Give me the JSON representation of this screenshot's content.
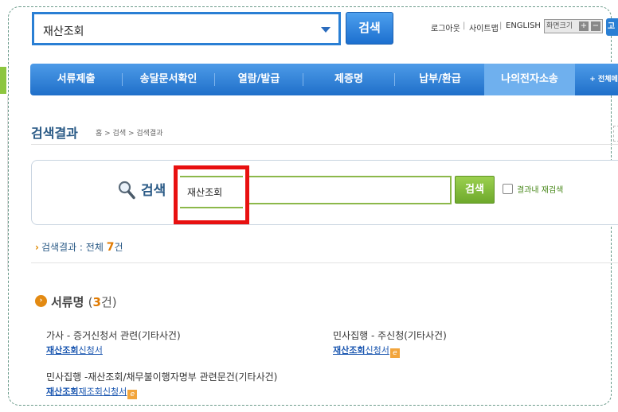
{
  "header": {
    "search_value": "재산조회",
    "search_button": "검색",
    "links": {
      "logout": "로그아웃",
      "sitemap": "사이트맵",
      "english": "ENGLISH",
      "separator": "|"
    },
    "font_size": {
      "label": "화면크기",
      "plus": "+",
      "minus": "−"
    },
    "edge_button": "고"
  },
  "nav": {
    "items": [
      "서류제출",
      "송달문서확인",
      "열람/발급",
      "제증명",
      "납부/환급",
      "나의전자소송"
    ],
    "active": "나의전자소송",
    "all_menu": "+ 전체메"
  },
  "page": {
    "title": "검색결과",
    "breadcrumb": "홈 > 검색 > 검색결과"
  },
  "search_box": {
    "label": "검색",
    "value": "재산조회",
    "button": "검색",
    "research_label": "결과내 재검색",
    "research_checked": false
  },
  "results": {
    "summary_label": "검색결과 : 전체",
    "total": "7",
    "unit": "건",
    "section": {
      "title": "서류명",
      "count": "3",
      "unit": "건"
    },
    "docs": [
      {
        "category": "가사 - 증거신청서 관련(기타사건)",
        "highlight": "재산조회",
        "rest": "신청서",
        "ie": false
      },
      {
        "category": "민사집행 - 주신청(기타사건)",
        "highlight": "재산조회",
        "rest": "신청서",
        "ie": true
      },
      {
        "category": "민사집행 -재산조회/채무불이행자명부 관련문건(기타사건)",
        "highlight": "재산조회",
        "rest": "재조회신청서",
        "ie": true
      }
    ]
  },
  "colors": {
    "primary_blue": "#2a7fd4",
    "green": "#8cb84a",
    "highlight_red": "#e81010",
    "accent_orange": "#e07a00"
  }
}
